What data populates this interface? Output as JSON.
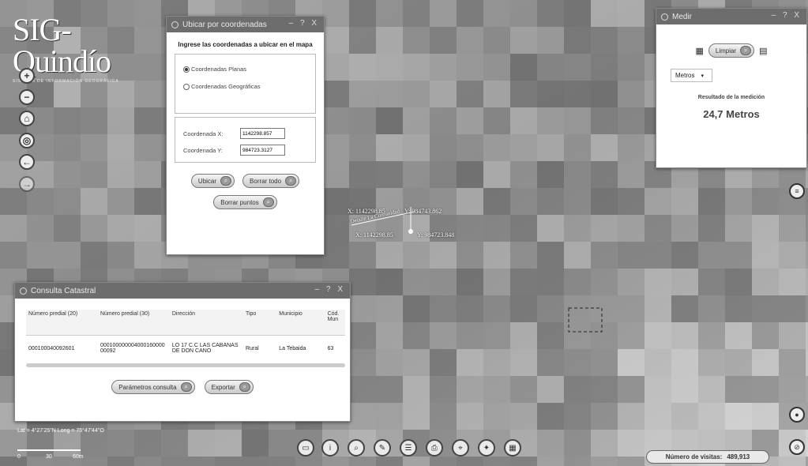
{
  "app": {
    "logo_name": "SIG-Quindío",
    "logo_tagline": "SISTEMA DE INFORMACIÓN GEOGRÁFICA"
  },
  "map_tools_left": [
    {
      "name": "zoom-in-icon",
      "glyph": "+"
    },
    {
      "name": "zoom-out-icon",
      "glyph": "−"
    },
    {
      "name": "home-icon",
      "glyph": "⌂"
    },
    {
      "name": "locate-icon",
      "glyph": "◎"
    },
    {
      "name": "back-icon",
      "glyph": "←"
    },
    {
      "name": "forward-icon",
      "glyph": "→"
    }
  ],
  "coord_window": {
    "title": "Ubicar por coordenadas",
    "controls": "– ? X",
    "heading": "Ingrese las coordenadas a ubicar en el mapa",
    "radio_planas": "Coordenadas Planas",
    "radio_geograficas": "Coordenadas Geográficas",
    "label_x": "Coordenada X:",
    "value_x": "1142298.857",
    "label_y": "Coordenada Y:",
    "value_y": "984723.3127",
    "btn_ubicar": "Ubicar",
    "btn_borrar_todo": "Borrar todo",
    "btn_borrar_puntos": "Borrar puntos"
  },
  "measure_window": {
    "title": "Medir",
    "controls": "– ? X",
    "btn_limpiar": "Limpiar",
    "unit_selected": "Metros",
    "result_label": "Resultado de la medición",
    "result_value": "24,7 Metros"
  },
  "catastro_window": {
    "title": "Consulta Catastral",
    "controls": "– ? X",
    "headers": [
      "Número predial (20)",
      "Número predial (30)",
      "Dirección",
      "Tipo",
      "Municipio",
      "Cód. Mun"
    ],
    "row": [
      "000100040092601",
      "00010000000400016000000092",
      "LO 17 C.C LAS CABANAS DE DON CANO",
      "Rural",
      "La Tebaida",
      "63"
    ],
    "btn_parametros": "Parámetros consulta",
    "btn_exportar": "Exportar"
  },
  "map_labels": {
    "point1": "X: 1142298.85",
    "point1_y": "Y: 984743.862",
    "point2": "X: 1142298.85",
    "point2_y": "Y: 984723.848",
    "segment": "Detalle La Comunidad"
  },
  "status": {
    "latlong": "Lat = 4°27'25\"N Long = 75°47'44\"O",
    "scale_labels": [
      "0",
      "30",
      "60m"
    ],
    "visits_label": "Número de visitas:",
    "visits_value": "489,913"
  },
  "bottom_tools": [
    "measure-icon",
    "info-icon",
    "zoom-box-icon",
    "draw-icon",
    "layers-icon",
    "print-icon",
    "coordinate-icon",
    "compass-icon",
    "basemap-icon"
  ]
}
